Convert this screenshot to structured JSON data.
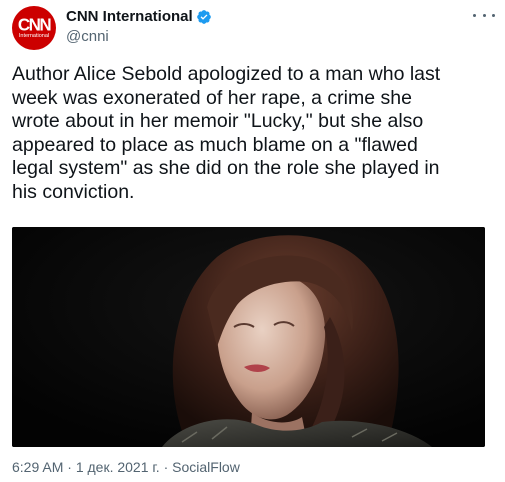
{
  "account": {
    "display_name": "CNN International",
    "handle": "@cnni",
    "avatar_text": "CNN",
    "avatar_subtext": "International"
  },
  "tweet": {
    "text": "Author Alice Sebold apologized to a man who last\nweek was exonerated of her rape, a crime she\nwrote about in her memoir \"Lucky,\" but she also\nappeared to place as much blame on a \"flawed\nlegal system\" as she did on the role she played in\nhis conviction.",
    "time": "6:29 AM",
    "separator": " · ",
    "date": "1 дек. 2021 г.",
    "source": "SocialFlow"
  },
  "icons": {
    "verified": "verified-badge-icon",
    "more": "more-options-icon"
  },
  "colors": {
    "brand_red": "#cc0000",
    "verified_blue": "#1d9bf0",
    "secondary_text": "#536471"
  }
}
